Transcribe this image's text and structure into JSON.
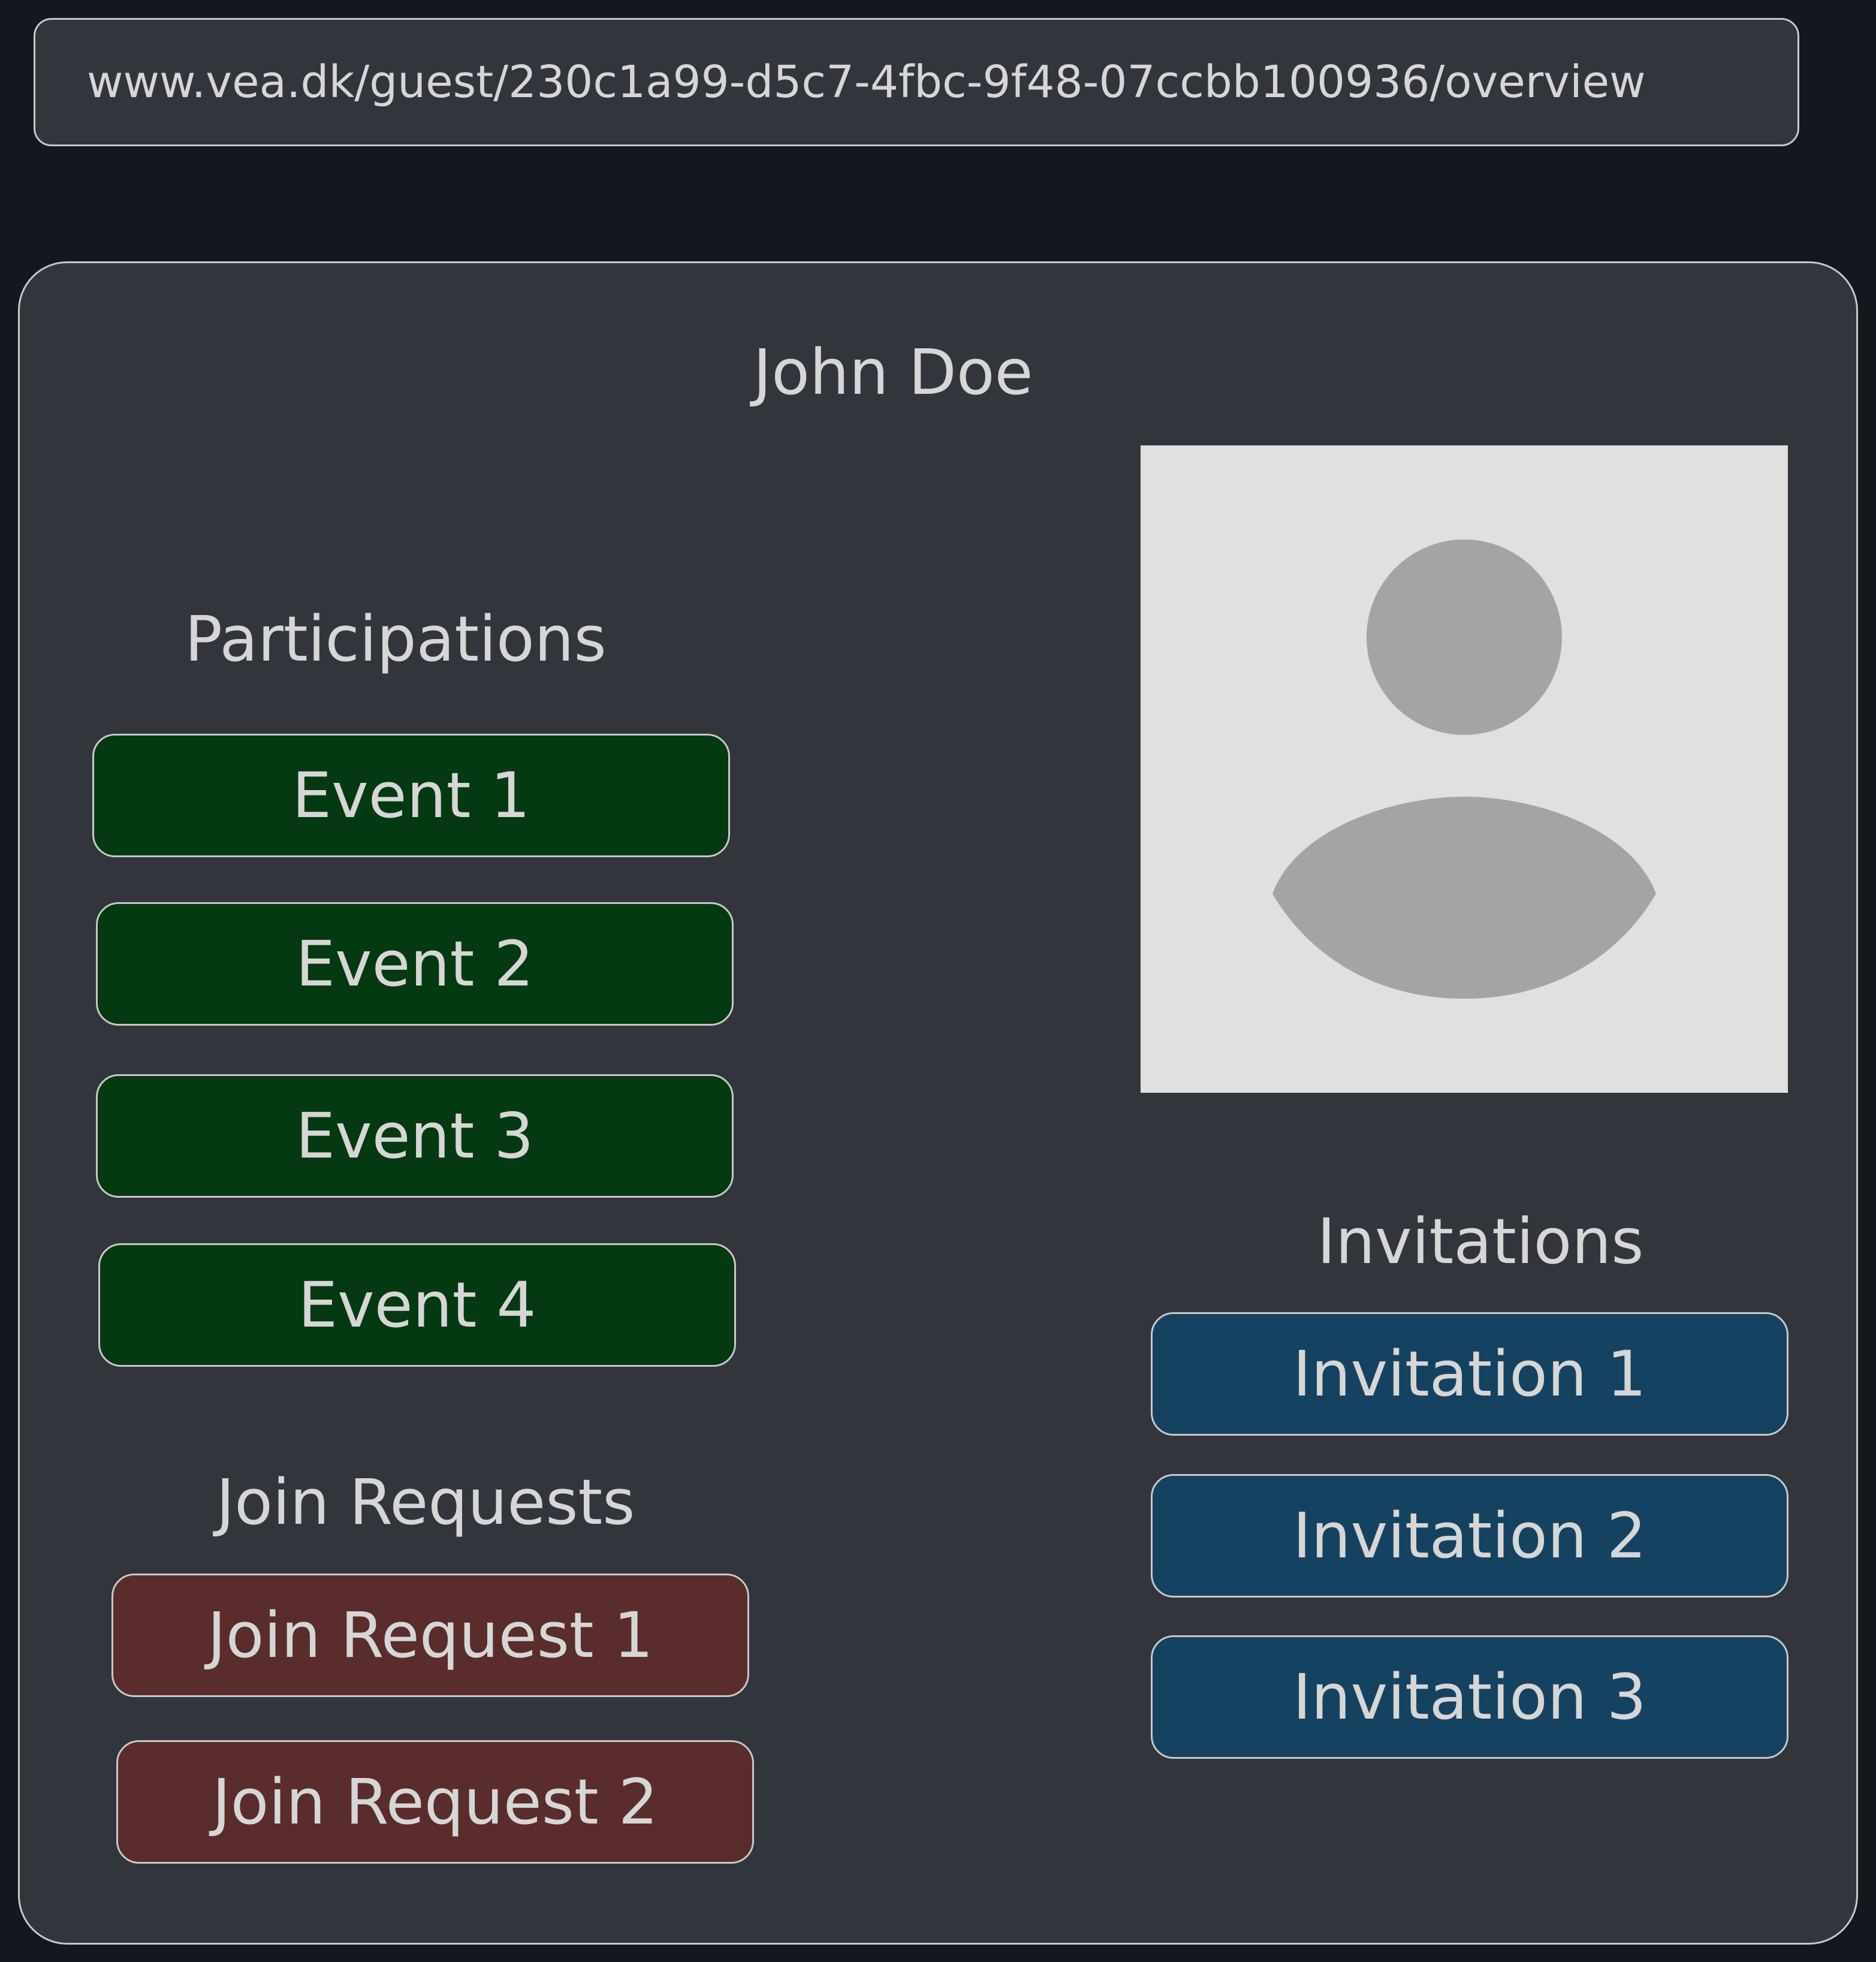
{
  "browser": {
    "url": "www.vea.dk/guest/230c1a99-d5c7-4fbc-9f48-07ccbb100936/overview"
  },
  "profile": {
    "name": "John Doe",
    "avatar_icon": "user-silhouette-icon"
  },
  "participations": {
    "heading": "Participations",
    "items": [
      "Event 1",
      "Event 2",
      "Event 3",
      "Event 4"
    ]
  },
  "join_requests": {
    "heading": "Join Requests",
    "items": [
      "Join Request 1",
      "Join Request 2"
    ]
  },
  "invitations": {
    "heading": "Invitations",
    "items": [
      "Invitation 1",
      "Invitation 2",
      "Invitation 3"
    ]
  },
  "colors": {
    "page_background": "#14171d",
    "panel_background": "#32363c",
    "event_button": "#053911",
    "join_request_button": "#5a2c2c",
    "invitation_button": "#164262",
    "avatar_background": "#e0e0e0",
    "avatar_silhouette": "#a4a4a4",
    "text": "#d6d6d6"
  }
}
